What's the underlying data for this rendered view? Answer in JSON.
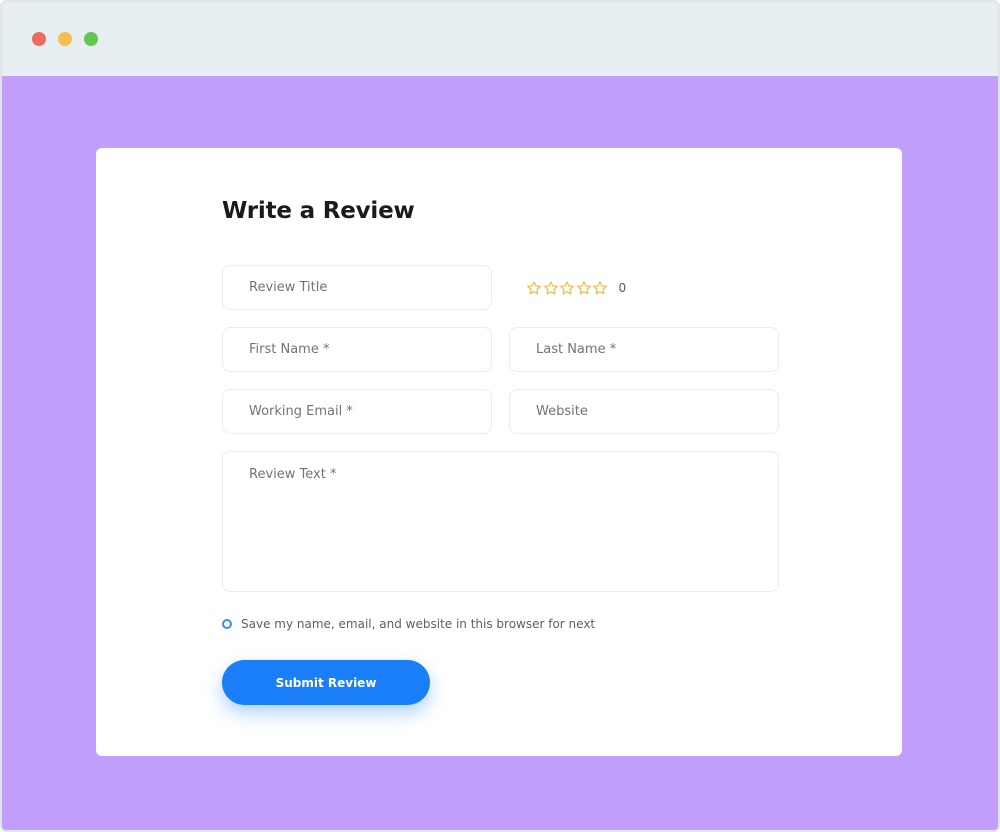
{
  "window": {
    "controls": [
      "close-dot",
      "minimize-dot",
      "maximize-dot"
    ]
  },
  "form": {
    "title": "Write a Review",
    "review_title_placeholder": "Review Title",
    "first_name_placeholder": "First Name *",
    "last_name_placeholder": "Last Name *",
    "email_placeholder": "Working Email *",
    "website_placeholder": "Website",
    "review_text_placeholder": "Review Text *",
    "rating": {
      "stars_total": 5,
      "stars_filled": 0,
      "count": "0",
      "icon": "star-outline-icon",
      "star_color": "#f5b942"
    },
    "remember_label": "Save my name, email, and website in this browser for next",
    "remember_checked": false,
    "submit_label": "Submit Review"
  },
  "colors": {
    "background": "#c29ffa",
    "titlebar": "#e8eff3",
    "accent": "#1a7ef8"
  }
}
